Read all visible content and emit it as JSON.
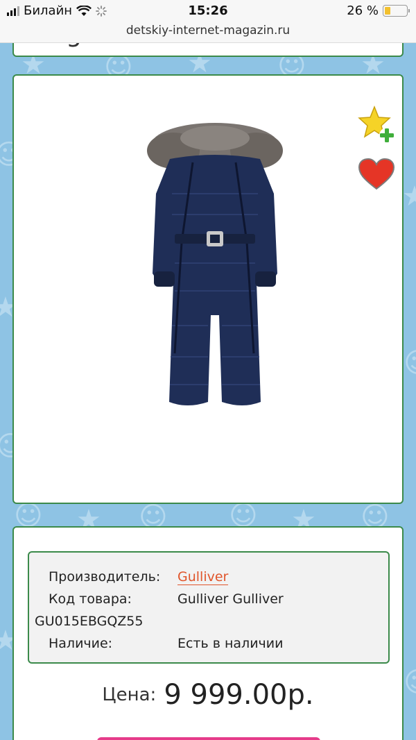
{
  "status_bar": {
    "carrier": "Билайн",
    "time": "15:26",
    "battery_percent": "26 %",
    "battery_level": 0.26
  },
  "url_bar": {
    "url": "detskiy-internet-magazin.ru"
  },
  "header": {
    "logo_text_partial": "magazin.ru"
  },
  "product": {
    "wishlist_icon": "star-plus-icon",
    "favorite_icon": "heart-icon"
  },
  "specs": {
    "manufacturer_label": "Производитель:",
    "manufacturer_value": "Gulliver",
    "code_label": "Код товара:",
    "code_value_line1": "Gulliver Gulliver",
    "code_value_line2": "GU015EBGQZ55",
    "availability_label": "Наличие:",
    "availability_value": "Есть в наличии"
  },
  "price": {
    "label": "Цена:",
    "value": "9 999.00р."
  },
  "colors": {
    "card_border": "#3b8a4a",
    "page_bg": "#8ec3e4",
    "link": "#e0552b",
    "buy_button": "#e63b8a"
  }
}
